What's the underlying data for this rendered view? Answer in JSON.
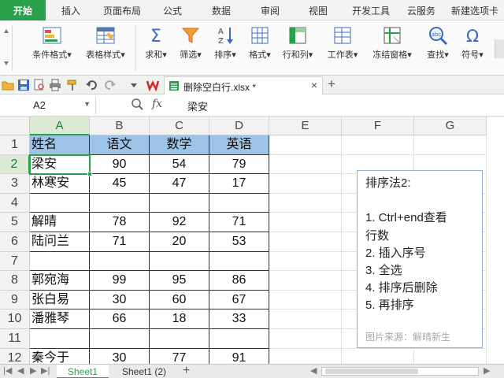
{
  "ribbon_tabs": [
    "开始",
    "插入",
    "页面布局",
    "公式",
    "数据",
    "审阅",
    "视图",
    "开发工具",
    "云服务",
    "新建选项卡"
  ],
  "ribbon": {
    "conditional_format": "条件格式",
    "table_style": "表格样式",
    "sum": "求和",
    "filter": "筛选",
    "sort": "排序",
    "format": "格式",
    "row_col": "行和列",
    "worksheet": "工作表",
    "freeze": "冻结窗格",
    "find": "查找",
    "symbol": "符号",
    "dropdown_marker": "▾"
  },
  "document": {
    "tab_title": "删除空白行.xlsx *",
    "close": "×",
    "new_tab": "+"
  },
  "formula_bar": {
    "cell_ref": "A2",
    "fx": "fx",
    "value": "梁安"
  },
  "columns": [
    "A",
    "B",
    "C",
    "D",
    "E",
    "F",
    "G"
  ],
  "row_numbers": [
    "1",
    "2",
    "3",
    "4",
    "5",
    "6",
    "7",
    "8",
    "9",
    "10",
    "11",
    "12"
  ],
  "table": {
    "headers": [
      "姓名",
      "语文",
      "数学",
      "英语"
    ],
    "rows": [
      [
        "梁安",
        "90",
        "54",
        "79"
      ],
      [
        "林寒安",
        "45",
        "47",
        "17"
      ],
      [
        "",
        "",
        "",
        ""
      ],
      [
        "解晴",
        "78",
        "92",
        "71"
      ],
      [
        "陆问兰",
        "71",
        "20",
        "53"
      ],
      [
        "",
        "",
        "",
        ""
      ],
      [
        "郭宛海",
        "99",
        "95",
        "86"
      ],
      [
        "张白易",
        "30",
        "60",
        "67"
      ],
      [
        "潘雅琴",
        "66",
        "18",
        "33"
      ],
      [
        "",
        "",
        "",
        ""
      ],
      [
        "秦今于",
        "30",
        "77",
        "91"
      ]
    ]
  },
  "note": {
    "lines": [
      "排序法2:",
      "",
      "1. Ctrl+end查看",
      "行数",
      "2. 插入序号",
      "3. 全选",
      "4. 排序后删除",
      "5. 再排序"
    ],
    "source": "图片来源：解晴新生"
  },
  "sheets": {
    "tabs": [
      "Sheet1",
      "Sheet1 (2)"
    ],
    "add": "+"
  },
  "colors": {
    "accent": "#2aa04a",
    "header_fill": "#9dc3e6"
  }
}
